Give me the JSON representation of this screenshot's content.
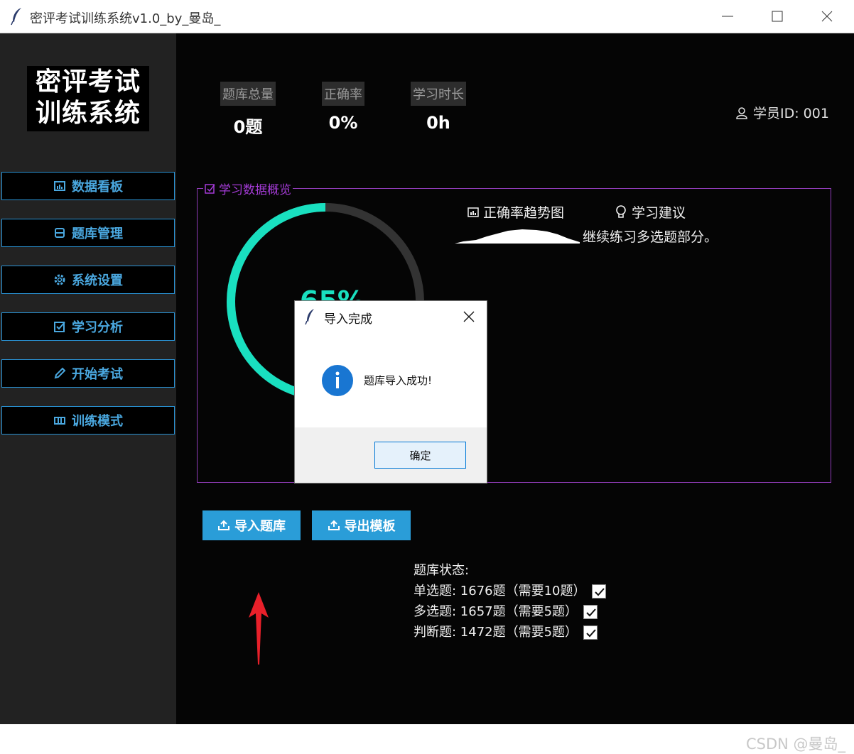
{
  "window": {
    "title": "密评考试训练系统v1.0_by_曼岛_"
  },
  "sidebar": {
    "logo_line1": "密评考试",
    "logo_line2": "训练系统",
    "items": [
      {
        "label": "数据看板",
        "icon": "dashboard-icon"
      },
      {
        "label": "题库管理",
        "icon": "database-icon"
      },
      {
        "label": "系统设置",
        "icon": "gear-icon"
      },
      {
        "label": "学习分析",
        "icon": "checkbox-icon"
      },
      {
        "label": "开始考试",
        "icon": "pencil-icon"
      },
      {
        "label": "训练模式",
        "icon": "book-icon"
      }
    ]
  },
  "stats": [
    {
      "label": "题库总量",
      "value": "0题"
    },
    {
      "label": "正确率",
      "value": "0%"
    },
    {
      "label": "学习时长",
      "value": "0h"
    }
  ],
  "user": {
    "id_label": "学员ID: 001"
  },
  "overview": {
    "legend": "学习数据概览",
    "progress_label": "65%",
    "progress_fraction": 0.65,
    "trend_label": "正确率趋势图",
    "advice_label": "学习建议",
    "advice_text": "继续练习多选题部分。"
  },
  "actions": {
    "import_label": "导入题库",
    "export_label": "导出模板"
  },
  "bank_status": {
    "title": "题库状态:",
    "rows": [
      {
        "text": "单选题: 1676题（需要10题）",
        "ok": true
      },
      {
        "text": "多选题: 1657题（需要5题）",
        "ok": true
      },
      {
        "text": "判断题: 1472题（需要5题）",
        "ok": true
      }
    ]
  },
  "dialog": {
    "title": "导入完成",
    "message": "题库导入成功!",
    "ok_label": "确定"
  },
  "watermark": "CSDN @曼岛_",
  "colors": {
    "accent": "#2a9dd8",
    "progress": "#19e0c0",
    "panel_border": "#8e3bb5",
    "arrow": "#e8202a"
  }
}
